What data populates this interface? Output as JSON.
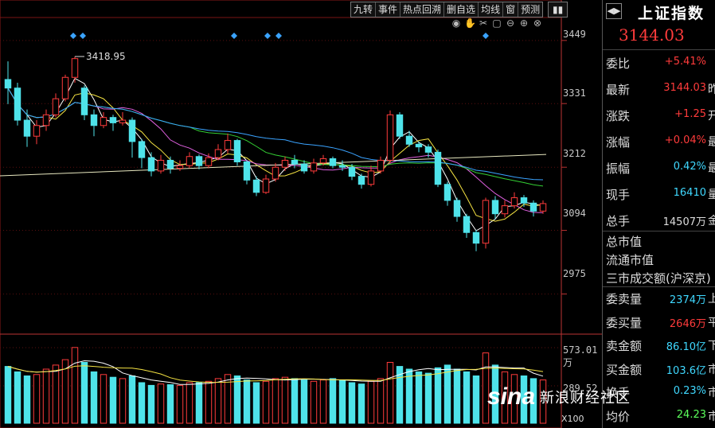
{
  "toolbar": [
    "九转",
    "事件",
    "热点回溯",
    "删自选",
    "均线",
    "窗",
    "预测"
  ],
  "tools": [
    "eye-icon",
    "hand-icon",
    "scissors-icon",
    "settings-icon",
    "minus-zoom-icon",
    "plus-zoom-icon",
    "close-icon"
  ],
  "y_axis": [
    "3449",
    "3331",
    "3212",
    "3094",
    "2975"
  ],
  "vol_axis": [
    "573.01万",
    "289.52"
  ],
  "high_label": "3418.95",
  "x100": "X100",
  "panel": {
    "title": "上证指数",
    "price": "3144.03",
    "rows": [
      {
        "label": "委比",
        "value": "+5.41%",
        "ext": "",
        "color": "#ff3b3b"
      },
      {
        "label": "最新",
        "value": "3144.03",
        "ext": "昨",
        "color": "#ff3b3b"
      },
      {
        "label": "涨跌",
        "value": "+1.25",
        "ext": "开",
        "color": "#ff3b3b"
      },
      {
        "label": "涨幅",
        "value": "+0.04%",
        "ext": "最",
        "color": "#ff3b3b"
      },
      {
        "label": "振幅",
        "value": "0.42%",
        "ext": "最",
        "color": "#3fd8ff"
      },
      {
        "label": "现手",
        "value": "16410",
        "ext": "量",
        "color": "#3fd8ff"
      },
      {
        "label": "总手",
        "value": "14507万",
        "ext": "金",
        "color": "#ddd"
      }
    ],
    "mid": [
      "总市值",
      "流通市值",
      "三市成交额(沪深京)"
    ],
    "rows2": [
      {
        "label": "委卖量",
        "value": "2374万",
        "ext": "上",
        "color": "#3fd8ff"
      },
      {
        "label": "委买量",
        "value": "2646万",
        "ext": "平",
        "color": "#ff3b3b"
      },
      {
        "label": "卖金额",
        "value": "86.10亿",
        "ext": "下",
        "color": "#3fd8ff"
      },
      {
        "label": "买金额",
        "value": "103.6亿",
        "ext": "市",
        "color": "#3fd8ff"
      },
      {
        "label": "换手",
        "value": "0.23%",
        "ext": "市",
        "color": "#3fd8ff"
      },
      {
        "label": "均价",
        "value": "24.23",
        "ext": "市",
        "color": "#5cff5c"
      }
    ]
  },
  "watermark": {
    "logo": "sina",
    "text": "新浪财经社区"
  },
  "chart_data": {
    "type": "candlestick",
    "ylim": [
      2900,
      3480
    ],
    "y_ticks": [
      3449,
      3331,
      3212,
      3094,
      2975
    ],
    "candles": [
      [
        3376,
        3360,
        3410,
        3330
      ],
      [
        3360,
        3300,
        3370,
        3290
      ],
      [
        3300,
        3270,
        3320,
        3250
      ],
      [
        3270,
        3290,
        3300,
        3255
      ],
      [
        3290,
        3310,
        3320,
        3280
      ],
      [
        3310,
        3340,
        3350,
        3305
      ],
      [
        3340,
        3380,
        3385,
        3335
      ],
      [
        3380,
        3415,
        3419,
        3370
      ],
      [
        3360,
        3310,
        3365,
        3300
      ],
      [
        3310,
        3290,
        3320,
        3270
      ],
      [
        3290,
        3305,
        3315,
        3285
      ],
      [
        3305,
        3295,
        3310,
        3280
      ],
      [
        3295,
        3300,
        3315,
        3290
      ],
      [
        3300,
        3260,
        3305,
        3230
      ],
      [
        3260,
        3230,
        3265,
        3210
      ],
      [
        3230,
        3205,
        3240,
        3195
      ],
      [
        3205,
        3225,
        3235,
        3200
      ],
      [
        3225,
        3210,
        3232,
        3200
      ],
      [
        3210,
        3215,
        3225,
        3205
      ],
      [
        3215,
        3232,
        3240,
        3210
      ],
      [
        3232,
        3215,
        3236,
        3208
      ],
      [
        3215,
        3230,
        3238,
        3210
      ],
      [
        3230,
        3245,
        3255,
        3225
      ],
      [
        3245,
        3262,
        3275,
        3238
      ],
      [
        3262,
        3222,
        3265,
        3215
      ],
      [
        3222,
        3188,
        3225,
        3180
      ],
      [
        3188,
        3165,
        3195,
        3158
      ],
      [
        3165,
        3190,
        3198,
        3162
      ],
      [
        3190,
        3212,
        3220,
        3185
      ],
      [
        3212,
        3225,
        3232,
        3205
      ],
      [
        3225,
        3218,
        3235,
        3210
      ],
      [
        3218,
        3205,
        3225,
        3200
      ],
      [
        3205,
        3220,
        3228,
        3200
      ],
      [
        3220,
        3228,
        3235,
        3215
      ],
      [
        3228,
        3215,
        3232,
        3210
      ],
      [
        3215,
        3212,
        3225,
        3205
      ],
      [
        3212,
        3195,
        3218,
        3188
      ],
      [
        3195,
        3180,
        3200,
        3172
      ],
      [
        3180,
        3205,
        3215,
        3176
      ],
      [
        3205,
        3225,
        3232,
        3200
      ],
      [
        3225,
        3310,
        3318,
        3220
      ],
      [
        3310,
        3270,
        3315,
        3265
      ],
      [
        3270,
        3255,
        3280,
        3250
      ],
      [
        3255,
        3250,
        3260,
        3240
      ],
      [
        3250,
        3240,
        3255,
        3230
      ],
      [
        3240,
        3180,
        3245,
        3175
      ],
      [
        3180,
        3150,
        3185,
        3140
      ],
      [
        3150,
        3120,
        3155,
        3110
      ],
      [
        3120,
        3090,
        3125,
        3080
      ],
      [
        3090,
        3070,
        3095,
        3055
      ],
      [
        3070,
        3150,
        3155,
        3060
      ],
      [
        3150,
        3125,
        3158,
        3115
      ],
      [
        3125,
        3140,
        3150,
        3118
      ],
      [
        3140,
        3155,
        3165,
        3135
      ],
      [
        3155,
        3145,
        3160,
        3138
      ],
      [
        3145,
        3130,
        3150,
        3120
      ],
      [
        3130,
        3144,
        3150,
        3125
      ]
    ],
    "volumes": [
      420,
      380,
      350,
      360,
      400,
      430,
      470,
      560,
      450,
      380,
      360,
      340,
      330,
      350,
      300,
      280,
      290,
      285,
      280,
      300,
      300,
      310,
      330,
      360,
      350,
      320,
      300,
      310,
      330,
      340,
      330,
      320,
      310,
      320,
      330,
      320,
      300,
      290,
      310,
      330,
      450,
      420,
      400,
      380,
      370,
      410,
      430,
      400,
      380,
      350,
      520,
      430,
      380,
      360,
      350,
      330,
      320
    ]
  }
}
